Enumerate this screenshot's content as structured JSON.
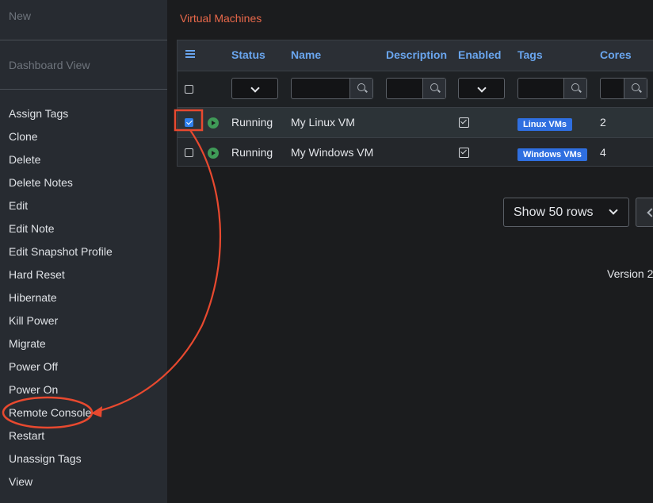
{
  "sidebar": {
    "top_items": [
      "New",
      "Dashboard View"
    ],
    "items": [
      "Assign Tags",
      "Clone",
      "Delete",
      "Delete Notes",
      "Edit",
      "Edit Note",
      "Edit Snapshot Profile",
      "Hard Reset",
      "Hibernate",
      "Kill Power",
      "Migrate",
      "Power Off",
      "Power On",
      "Remote Console",
      "Restart",
      "Unassign Tags",
      "View"
    ]
  },
  "page_title": "Virtual Machines",
  "grid": {
    "columns": [
      "Status",
      "Name",
      "Description",
      "Enabled",
      "Tags",
      "Cores"
    ],
    "rows": [
      {
        "checked": true,
        "status": "Running",
        "name": "My Linux VM",
        "enabled": true,
        "tag": "Linux VMs",
        "cores": "2"
      },
      {
        "checked": false,
        "status": "Running",
        "name": "My Windows VM",
        "enabled": true,
        "tag": "Windows VMs",
        "cores": "4"
      }
    ]
  },
  "pager": {
    "rows_label": "Show 50 rows"
  },
  "footer": {
    "version": "Version 2"
  },
  "colors": {
    "accent": "#6aa6ef",
    "title": "#e8684a",
    "annotation": "#e8492f",
    "tag_bg": "#2f6fe0",
    "running": "#3f9a57"
  },
  "icons": [
    "menu-icon",
    "chevron-down-icon",
    "search-icon",
    "play-icon",
    "checkbox-icon",
    "chevron-left-icon"
  ]
}
